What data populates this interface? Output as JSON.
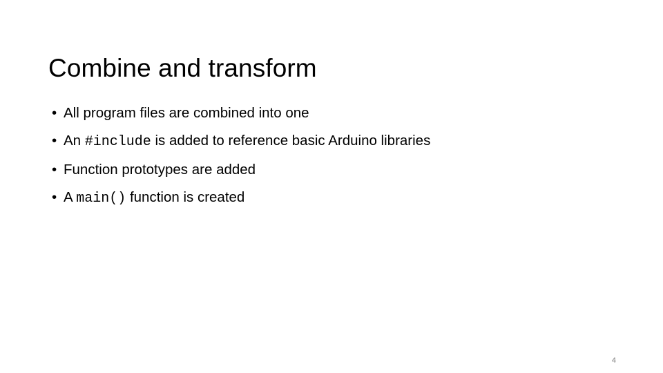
{
  "slide": {
    "title": "Combine and transform",
    "bullet_marker": "•",
    "bullets": [
      {
        "parts": [
          {
            "type": "text",
            "value": "All program files are combined into one"
          }
        ]
      },
      {
        "parts": [
          {
            "type": "text",
            "value": "An "
          },
          {
            "type": "code",
            "value": "#include"
          },
          {
            "type": "text",
            "value": "  is added to reference basic Arduino libraries"
          }
        ]
      },
      {
        "parts": [
          {
            "type": "text",
            "value": "Function prototypes are added"
          }
        ]
      },
      {
        "parts": [
          {
            "type": "text",
            "value": "A "
          },
          {
            "type": "code",
            "value": "main()"
          },
          {
            "type": "text",
            "value": " function is created"
          }
        ]
      }
    ],
    "page_number": "4",
    "colors": {
      "background": "#ffffff",
      "text": "#000000",
      "page_number": "#808080"
    }
  }
}
